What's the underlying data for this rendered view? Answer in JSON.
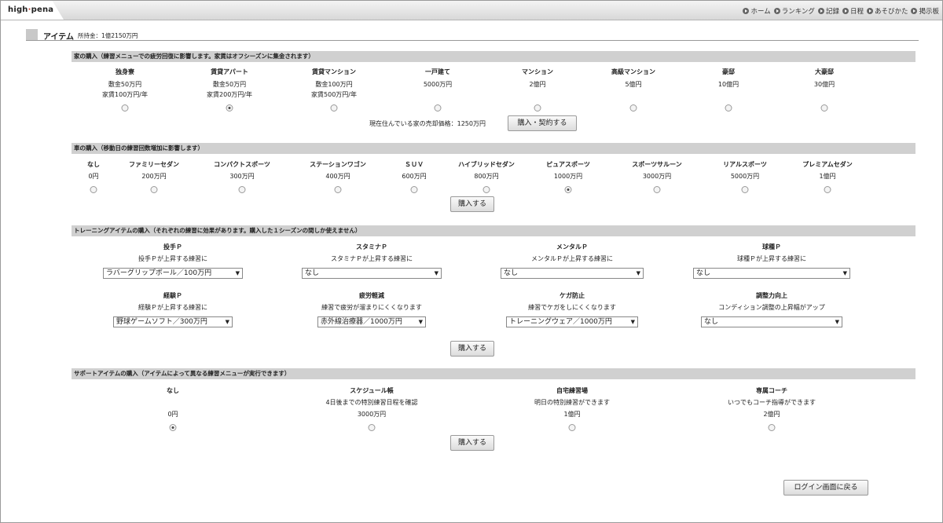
{
  "app": {
    "logo_main": "high",
    "logo_sub": "pena"
  },
  "nav": [
    "ホーム",
    "ランキング",
    "記録",
    "日程",
    "あそびかた",
    "掲示板"
  ],
  "header": {
    "title": "アイテム",
    "money": "所持金：1億2150万円"
  },
  "house": {
    "title": "家の購入（練習メニューでの疲労回復に影響します。家賃はオフシーズンに集金されます）",
    "items": [
      {
        "name": "独身寮",
        "l1": "敷金50万円",
        "l2": "家賃100万円/年"
      },
      {
        "name": "賃貸アパート",
        "l1": "敷金50万円",
        "l2": "家賃200万円/年"
      },
      {
        "name": "賃貸マンション",
        "l1": "敷金100万円",
        "l2": "家賃500万円/年"
      },
      {
        "name": "一戸建て",
        "l1": "5000万円",
        "l2": ""
      },
      {
        "name": "マンション",
        "l1": "2億円",
        "l2": ""
      },
      {
        "name": "高級マンション",
        "l1": "5億円",
        "l2": ""
      },
      {
        "name": "豪邸",
        "l1": "10億円",
        "l2": ""
      },
      {
        "name": "大豪邸",
        "l1": "30億円",
        "l2": ""
      }
    ],
    "selected": 1,
    "sale_price": "現在住んでいる家の売却価格：1250万円",
    "button": "購入・契約する"
  },
  "car": {
    "title": "車の購入（移動日の練習回数増加に影響します）",
    "items": [
      {
        "name": "なし",
        "price": "0円"
      },
      {
        "name": "ファミリーセダン",
        "price": "200万円"
      },
      {
        "name": "コンパクトスポーツ",
        "price": "300万円"
      },
      {
        "name": "ステーションワゴン",
        "price": "400万円"
      },
      {
        "name": "ＳＵＶ",
        "price": "600万円"
      },
      {
        "name": "ハイブリッドセダン",
        "price": "800万円"
      },
      {
        "name": "ピュアスポーツ",
        "price": "1000万円"
      },
      {
        "name": "スポーツサルーン",
        "price": "3000万円"
      },
      {
        "name": "リアルスポーツ",
        "price": "5000万円"
      },
      {
        "name": "プレミアムセダン",
        "price": "1億円"
      }
    ],
    "selected": 6,
    "button": "購入する"
  },
  "training": {
    "title": "トレーニングアイテムの購入（それぞれの練習に効果があります。購入した１シーズンの間しか使えません）",
    "items": [
      {
        "name": "投手Ｐ",
        "desc": "投手Ｐが上昇する練習に",
        "value": "ラバーグリップボール／100万円"
      },
      {
        "name": "スタミナＰ",
        "desc": "スタミナＰが上昇する練習に",
        "value": "なし"
      },
      {
        "name": "メンタルＰ",
        "desc": "メンタルＰが上昇する練習に",
        "value": "なし"
      },
      {
        "name": "球種Ｐ",
        "desc": "球種Ｐが上昇する練習に",
        "value": "なし"
      },
      {
        "name": "経験Ｐ",
        "desc": "経験Ｐが上昇する練習に",
        "value": "野球ゲームソフト／300万円"
      },
      {
        "name": "疲労軽減",
        "desc": "練習で疲労が溜まりにくくなります",
        "value": "赤外線治療器／1000万円"
      },
      {
        "name": "ケガ防止",
        "desc": "練習でケガをしにくくなります",
        "value": "トレーニングウェア／1000万円"
      },
      {
        "name": "調整力向上",
        "desc": "コンディション調整の上昇幅がアップ",
        "value": "なし"
      }
    ],
    "button": "購入する"
  },
  "support": {
    "title": "サポートアイテムの購入（アイテムによって異なる練習メニューが実行できます）",
    "items": [
      {
        "name": "なし",
        "desc": "",
        "price": "0円"
      },
      {
        "name": "スケジュール帳",
        "desc": "4日後までの特別練習日程を確認",
        "price": "3000万円"
      },
      {
        "name": "自宅練習場",
        "desc": "明日の特別練習ができます",
        "price": "1億円"
      },
      {
        "name": "専属コーチ",
        "desc": "いつでもコーチ指導ができます",
        "price": "2億円"
      }
    ],
    "selected": 0,
    "button": "購入する"
  },
  "footer": {
    "back_button": "ログイン画面に戻る"
  }
}
